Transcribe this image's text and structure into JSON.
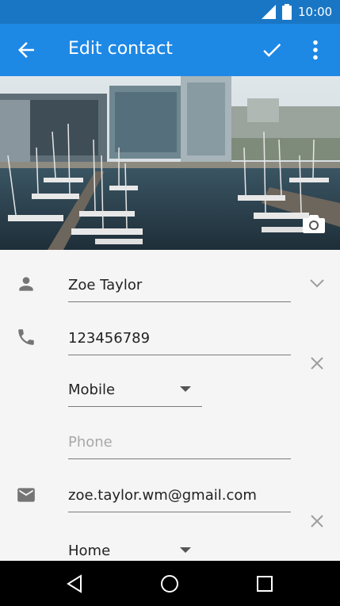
{
  "status_bar": {
    "time": "10:00"
  },
  "app_bar": {
    "title": "Edit contact"
  },
  "contact": {
    "name": "Zoe Taylor",
    "phone": "123456789",
    "phone_type": "Mobile",
    "new_phone_placeholder": "Phone",
    "email": "zoe.taylor.wm@gmail.com",
    "email_type": "Home"
  },
  "colors": {
    "status_bar": "#1976c4",
    "app_bar": "#1e88e5",
    "background": "#f5f5f5",
    "nav_bar": "#000000"
  },
  "icons": {
    "back": "arrow-back-icon",
    "save": "check-icon",
    "menu": "more-vert-icon",
    "photo": "camera-icon",
    "name": "person-icon",
    "phone": "phone-icon",
    "email": "email-icon"
  }
}
